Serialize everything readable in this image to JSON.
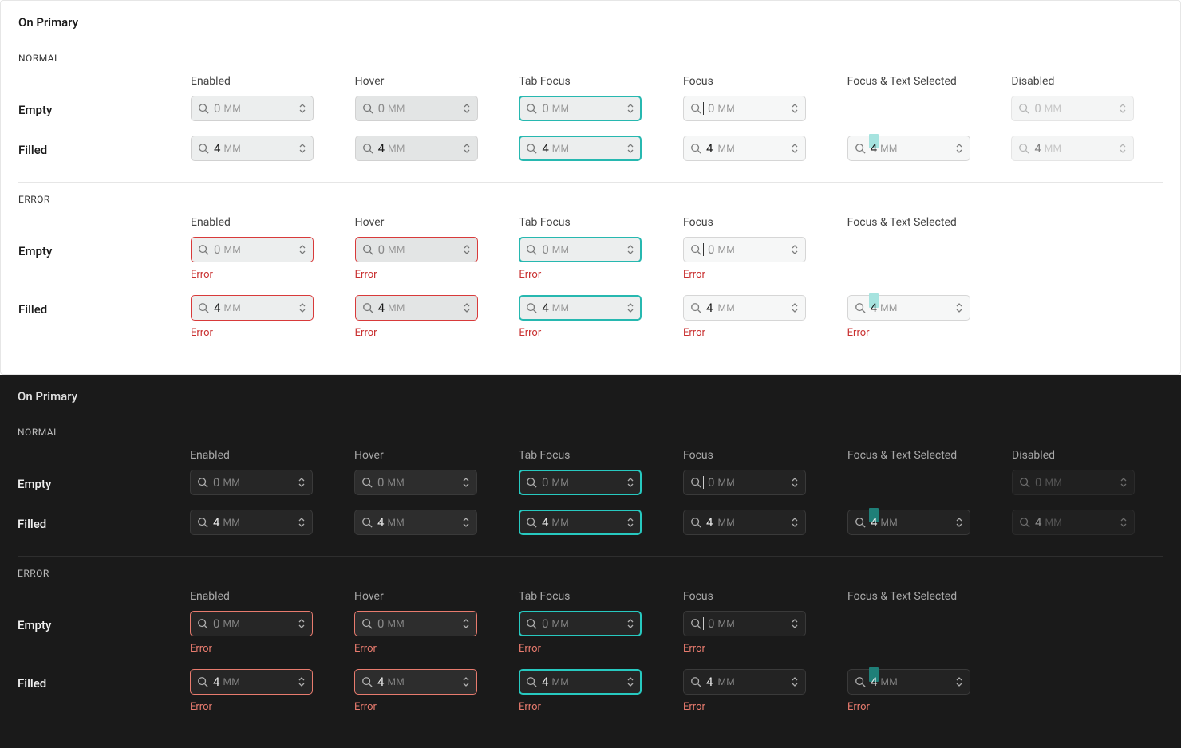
{
  "panel_title": "On Primary",
  "section_normal": "NORMAL",
  "section_error": "ERROR",
  "columns": {
    "enabled": "Enabled",
    "hover": "Hover",
    "tab_focus": "Tab Focus",
    "focus": "Focus",
    "focus_text_selected": "Focus & Text Selected",
    "disabled": "Disabled"
  },
  "rows": {
    "empty": "Empty",
    "filled": "Filled"
  },
  "placeholder": "0",
  "value": "4",
  "unit": "MM",
  "error_label": "Error"
}
